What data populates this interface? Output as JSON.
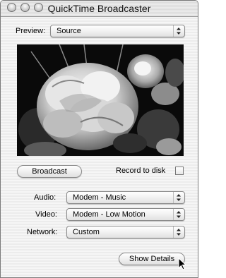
{
  "window": {
    "title": "QuickTime Broadcaster"
  },
  "preview": {
    "label": "Preview:",
    "selected": "Source"
  },
  "broadcast": {
    "button_label": "Broadcast",
    "record_label": "Record to disk",
    "record_checked": false
  },
  "settings": {
    "audio": {
      "label": "Audio:",
      "selected": "Modem - Music"
    },
    "video": {
      "label": "Video:",
      "selected": "Modem - Low Motion"
    },
    "network": {
      "label": "Network:",
      "selected": "Custom"
    }
  },
  "details": {
    "button_label": "Show Details"
  }
}
